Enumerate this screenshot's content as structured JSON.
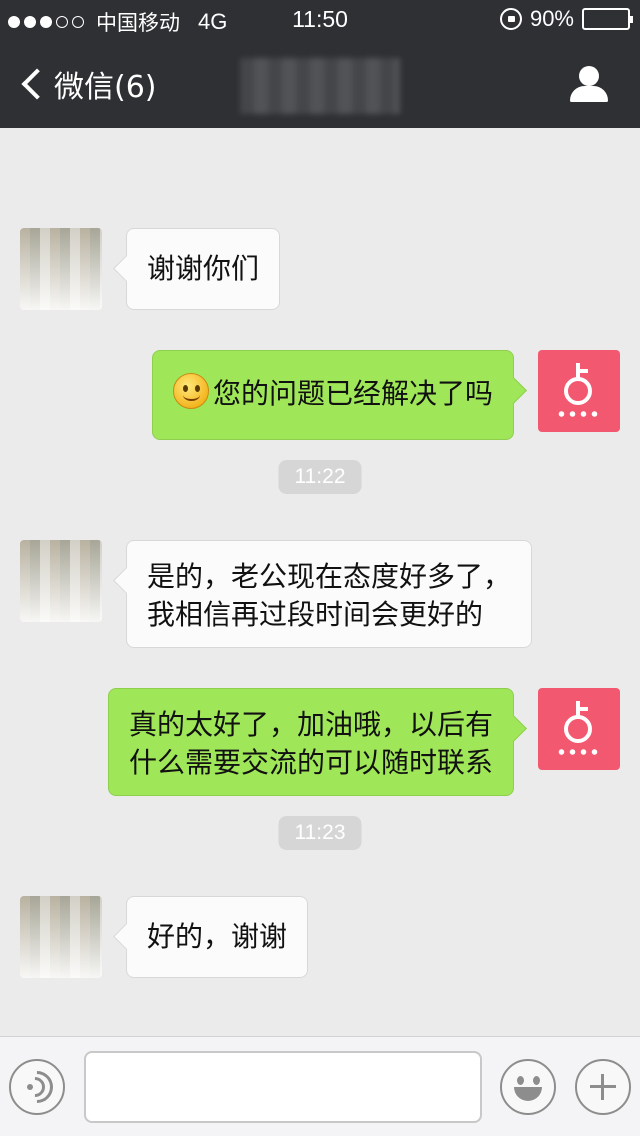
{
  "status_bar": {
    "carrier": "中国移动",
    "network": "4G",
    "time": "11:50",
    "battery": "90%",
    "battery_level": 0.9,
    "signal_bars_on": 3
  },
  "nav": {
    "back_label": "微信(6)",
    "back_icon": "chevron-left-icon",
    "profile_icon": "person-icon"
  },
  "messages": [
    {
      "from": "them",
      "text": "谢谢你们"
    },
    {
      "from": "me",
      "emoji": "smile-emoji",
      "text": "您的问题已经解决了吗"
    },
    {
      "type": "timestamp",
      "text": "11:22"
    },
    {
      "from": "them",
      "lines": [
        "是的，老公现在态度好多了，",
        "我相信再过段时间会更好的"
      ]
    },
    {
      "from": "me",
      "lines": [
        "真的太好了，加油哦，以后有",
        "什么需要交流的可以随时联系"
      ]
    },
    {
      "type": "timestamp",
      "text": "11:23"
    },
    {
      "from": "them",
      "text": "好的，谢谢"
    }
  ],
  "input_bar": {
    "voice_icon": "voice-icon",
    "text_value": "",
    "emoji_icon": "emoji-icon",
    "plus_icon": "plus-icon"
  },
  "colors": {
    "header_bg": "#2e3033",
    "chat_bg": "#ebebeb",
    "my_bubble": "#9fe658",
    "their_bubble": "#fbfbfb",
    "my_avatar": "#f2586f"
  }
}
